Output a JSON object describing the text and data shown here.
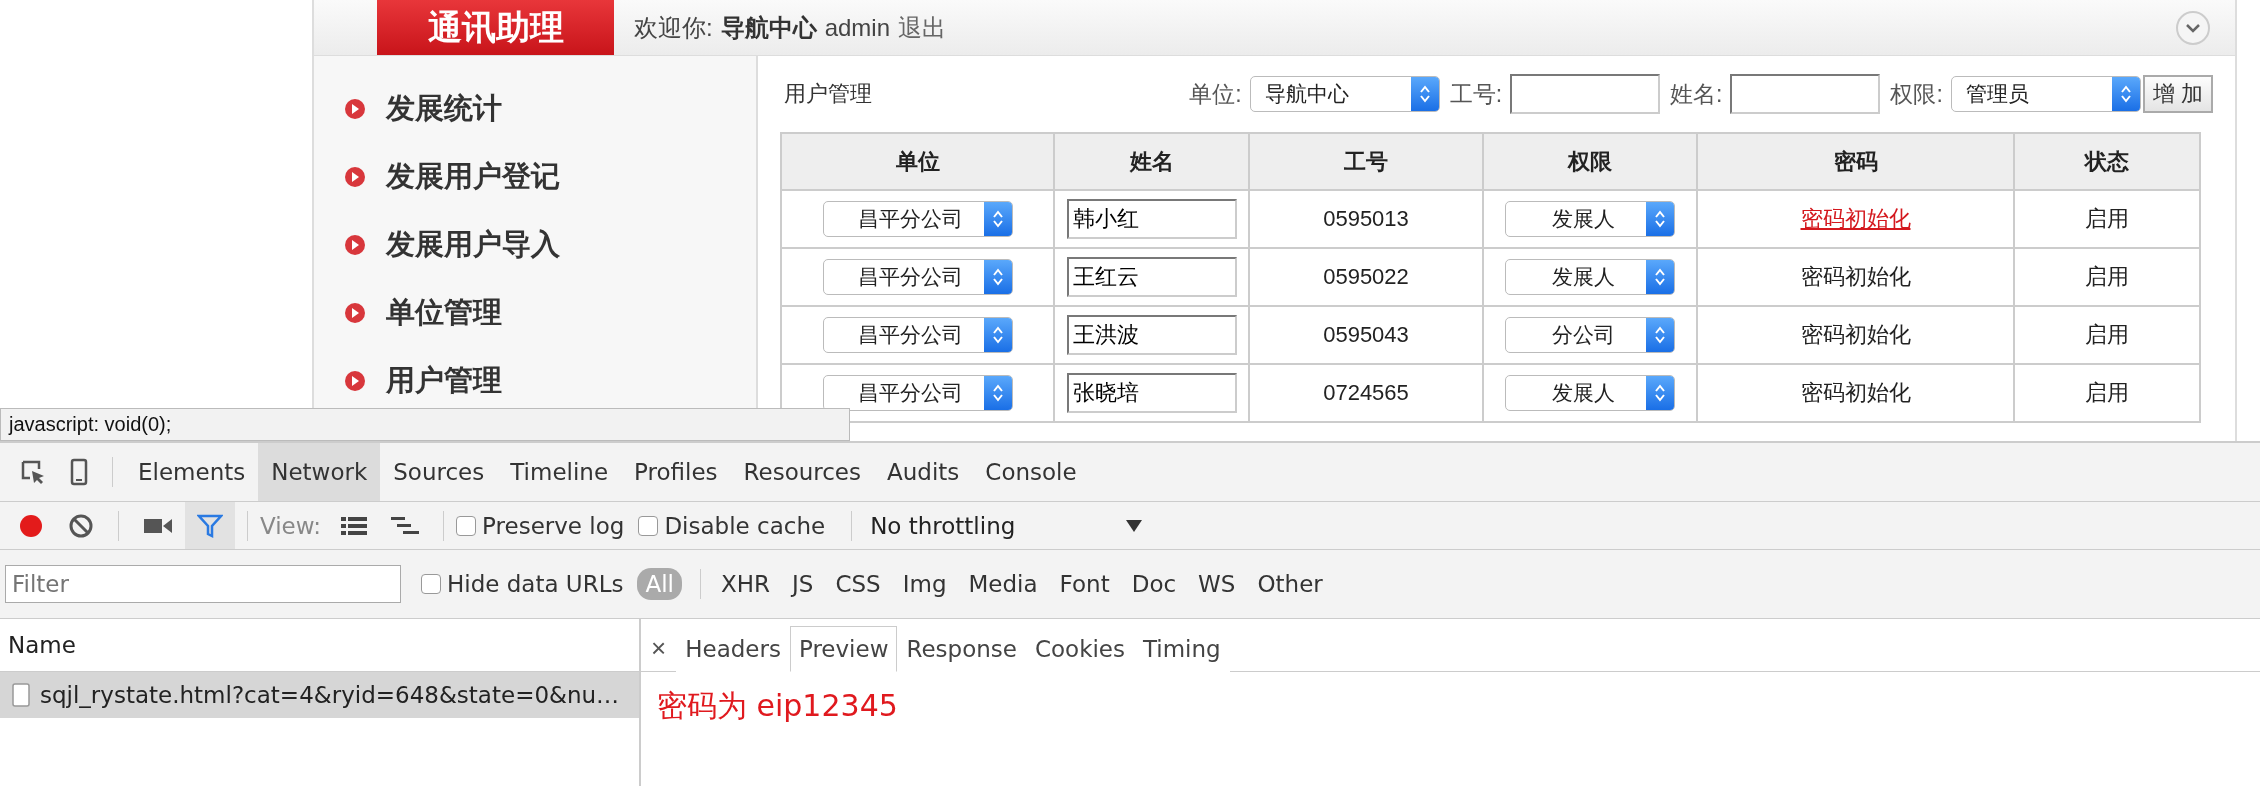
{
  "page": {
    "logo": "通讯助理",
    "welcome": {
      "label": "欢迎你:",
      "unit": "导航中心",
      "user": "admin",
      "logout": "退出"
    },
    "sidebar": [
      {
        "label": "发展统计"
      },
      {
        "label": "发展用户登记"
      },
      {
        "label": "发展用户导入"
      },
      {
        "label": "单位管理"
      },
      {
        "label": "用户管理"
      }
    ],
    "content": {
      "title": "用户管理",
      "filters": [
        {
          "kind": "select",
          "label": "单位:",
          "value": "导航中心"
        },
        {
          "kind": "input",
          "label": "工号:"
        },
        {
          "kind": "input",
          "label": "姓名:"
        },
        {
          "kind": "select",
          "label": "权限:",
          "value": "管理员"
        }
      ],
      "add_button": "增 加",
      "table": {
        "columns": [
          "单位",
          "姓名",
          "工号",
          "权限",
          "密码",
          "状态"
        ],
        "rows": [
          {
            "unit": "昌平分公司",
            "name": "韩小红",
            "id": "0595013",
            "role": "发展人",
            "reset": "密码初始化",
            "hovered": true,
            "status": "启用"
          },
          {
            "unit": "昌平分公司",
            "name": "王红云",
            "id": "0595022",
            "role": "发展人",
            "reset": "密码初始化",
            "hovered": false,
            "status": "启用"
          },
          {
            "unit": "昌平分公司",
            "name": "王洪波",
            "id": "0595043",
            "role": "分公司",
            "reset": "密码初始化",
            "hovered": false,
            "status": "启用"
          },
          {
            "unit": "昌平分公司",
            "name": "张晓培",
            "id": "0724565",
            "role": "发展人",
            "reset": "密码初始化",
            "hovered": false,
            "status": "启用"
          }
        ]
      }
    },
    "status_tooltip": "javascript: void(0);"
  },
  "devtools": {
    "tabs": [
      {
        "label": "Elements",
        "selected": false
      },
      {
        "label": "Network",
        "selected": true
      },
      {
        "label": "Sources",
        "selected": false
      },
      {
        "label": "Timeline",
        "selected": false
      },
      {
        "label": "Profiles",
        "selected": false
      },
      {
        "label": "Resources",
        "selected": false
      },
      {
        "label": "Audits",
        "selected": false
      },
      {
        "label": "Console",
        "selected": false
      }
    ],
    "toolbar": {
      "recording": true,
      "filter_on": true,
      "view_label": "View:",
      "checkboxes": [
        {
          "label": "Preserve log",
          "checked": false
        },
        {
          "label": "Disable cache",
          "checked": false
        }
      ],
      "throttling": "No throttling"
    },
    "filter": {
      "placeholder": "Filter",
      "hide_data_urls": {
        "label": "Hide data URLs",
        "checked": false
      },
      "types": [
        {
          "label": "All",
          "selected": true
        },
        {
          "label": "XHR",
          "selected": false
        },
        {
          "label": "JS",
          "selected": false
        },
        {
          "label": "CSS",
          "selected": false
        },
        {
          "label": "Img",
          "selected": false
        },
        {
          "label": "Media",
          "selected": false
        },
        {
          "label": "Font",
          "selected": false
        },
        {
          "label": "Doc",
          "selected": false
        },
        {
          "label": "WS",
          "selected": false
        },
        {
          "label": "Other",
          "selected": false
        }
      ]
    },
    "requests": {
      "column": "Name",
      "rows": [
        {
          "name": "sqjl_rystate.html?cat=4&ryid=648&state=0&nu…",
          "selected": true
        }
      ]
    },
    "detail": {
      "close": "×",
      "tabs": [
        {
          "label": "Headers",
          "selected": false
        },
        {
          "label": "Preview",
          "selected": true
        },
        {
          "label": "Response",
          "selected": false
        },
        {
          "label": "Cookies",
          "selected": false
        },
        {
          "label": "Timing",
          "selected": false
        }
      ],
      "preview": "密码为 eip12345"
    }
  }
}
